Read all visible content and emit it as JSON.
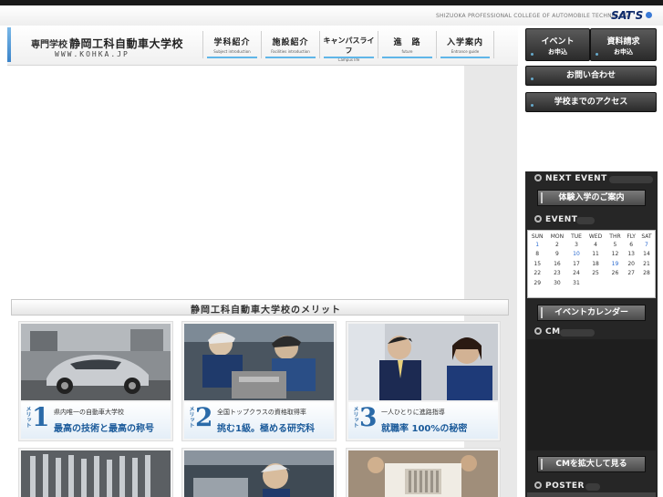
{
  "tagline": "SHIZUOKA PROFESSIONAL COLLEGE OF AUTOMOBILE TECHNOLOGY",
  "brand": "SAT'S",
  "logo": {
    "small": "専門学校",
    "main": "静岡工科自動車大学校",
    "url": "WWW.KOHKA.JP"
  },
  "nav": [
    {
      "ja": "学科紹介",
      "en": "Subject introduction"
    },
    {
      "ja": "施設紹介",
      "en": "Facilities introduction"
    },
    {
      "ja": "キャンパスライフ",
      "en": "Campus life"
    },
    {
      "ja": "進　路",
      "en": "future"
    },
    {
      "ja": "入学案内",
      "en": "Entrance guide"
    }
  ],
  "side_buttons": {
    "event": {
      "label": "イベント",
      "sub": "お申込"
    },
    "request": {
      "label": "資料請求",
      "sub": "お申込"
    },
    "contact": "お問い合わせ",
    "access": "学校までのアクセス"
  },
  "merit_title": "静岡工科自動車大学校のメリット",
  "merits": [
    {
      "label": "メリット",
      "num": "1",
      "small": "県内唯一の自動車大学校",
      "big": "最高の技術と最高の称号"
    },
    {
      "label": "メリット",
      "num": "2",
      "small": "全国トップクラスの資格取得率",
      "big": "挑む1級。極める研究科"
    },
    {
      "label": "メリット",
      "num": "3",
      "small": "一人ひとりに進路指導",
      "big": "就職率 100%の秘密"
    }
  ],
  "sidebar": {
    "next_event": "NEXT EVENT",
    "trial_button": "体験入学のご案内",
    "event": "EVENT",
    "calendar_button": "イベントカレンダー",
    "cm": "CM",
    "cm_button": "CMを拡大して見る",
    "poster": "POSTER"
  },
  "calendar": {
    "days": [
      "SUN",
      "MON",
      "TUE",
      "WED",
      "THR",
      "FLY",
      "SAT"
    ],
    "weeks": [
      [
        "1",
        "2",
        "3",
        "4",
        "5",
        "6",
        "7"
      ],
      [
        "8",
        "9",
        "10",
        "11",
        "12",
        "13",
        "14"
      ],
      [
        "15",
        "16",
        "17",
        "18",
        "19",
        "20",
        "21"
      ],
      [
        "22",
        "23",
        "24",
        "25",
        "26",
        "27",
        "28"
      ],
      [
        "29",
        "30",
        "31",
        "",
        "",
        "",
        ""
      ]
    ],
    "event_days": [
      "1",
      "10",
      "19"
    ],
    "highlight_days": [
      "7"
    ]
  },
  "colors": {
    "accent": "#2a6aa8",
    "nav_underline": "#5fb6e8",
    "sidebar_bg": "#262626"
  }
}
